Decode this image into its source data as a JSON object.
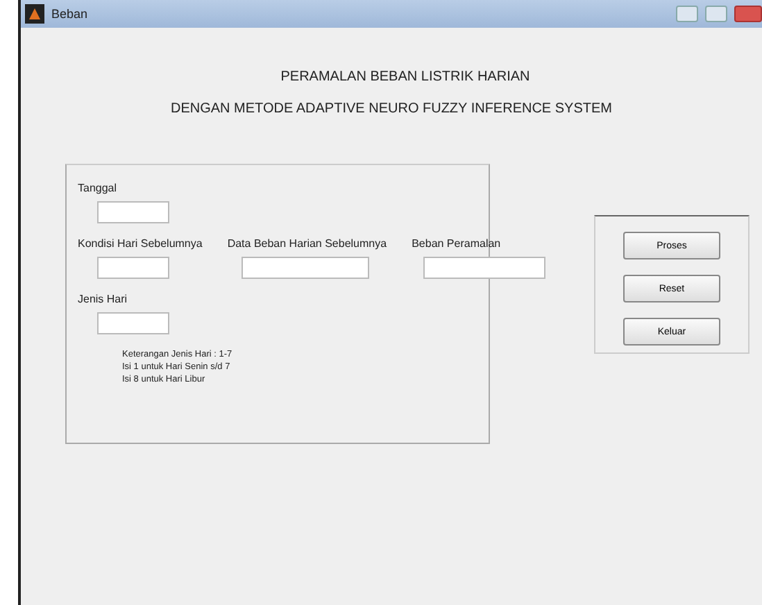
{
  "window": {
    "title": "Beban"
  },
  "headings": [
    "PERAMALAN BEBAN LISTRIK HARIAN",
    "DENGAN METODE ADAPTIVE NEURO FUZZY INFERENCE SYSTEM"
  ],
  "fields": [
    {
      "label": "Tanggal"
    },
    {
      "label": "Kondisi Hari Sebelumnya"
    },
    {
      "label": "Data Beban Harian Sebelumnya"
    },
    {
      "label": "Beban Peramalan"
    },
    {
      "label": "Jenis Hari"
    }
  ],
  "notes": [
    "Keterangan Jenis Hari : 1-7",
    "Isi 1 untuk Hari Senin s/d 7",
    "Isi 8 untuk Hari Libur"
  ],
  "buttons": [
    "Proses",
    "Reset",
    "Keluar"
  ]
}
